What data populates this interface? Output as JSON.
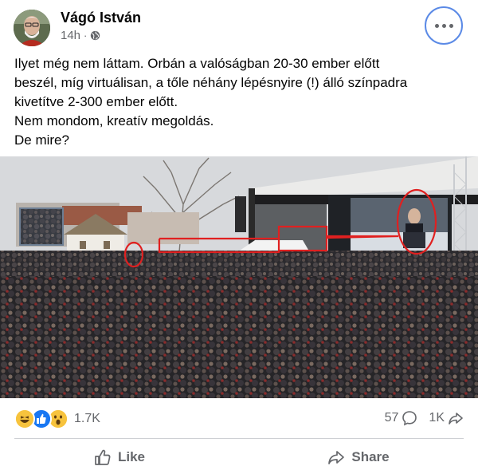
{
  "post": {
    "author": "Vágó István",
    "time": "14h",
    "separator": "·",
    "text_lines": [
      "Ilyet még nem láttam. Orbán a valóságban 20-30 ember előtt",
      "beszél, míg virtuálisan, a tőle néhány lépésnyire (!) álló színpadra",
      "kivetítve 2-300 ember előtt.",
      "Nem mondom, kreatív megoldás.",
      "De mire?"
    ]
  },
  "stats": {
    "reactions_count": "1.7K",
    "comments_count": "57",
    "shares_count": "1K"
  },
  "actions": {
    "like_label": "Like",
    "share_label": "Share"
  },
  "icons": {
    "more": "more-options-icon",
    "privacy": "globe-icon",
    "reactions": [
      "haha-reaction-icon",
      "like-reaction-icon",
      "wow-reaction-icon"
    ],
    "comment": "comment-icon",
    "share_stat": "share-arrow-icon",
    "like": "thumbs-up-icon",
    "share": "share-icon"
  },
  "colors": {
    "text": "#050505",
    "secondary": "#65676b",
    "like_blue": "#1877f2",
    "annotation_red": "#e02020"
  }
}
